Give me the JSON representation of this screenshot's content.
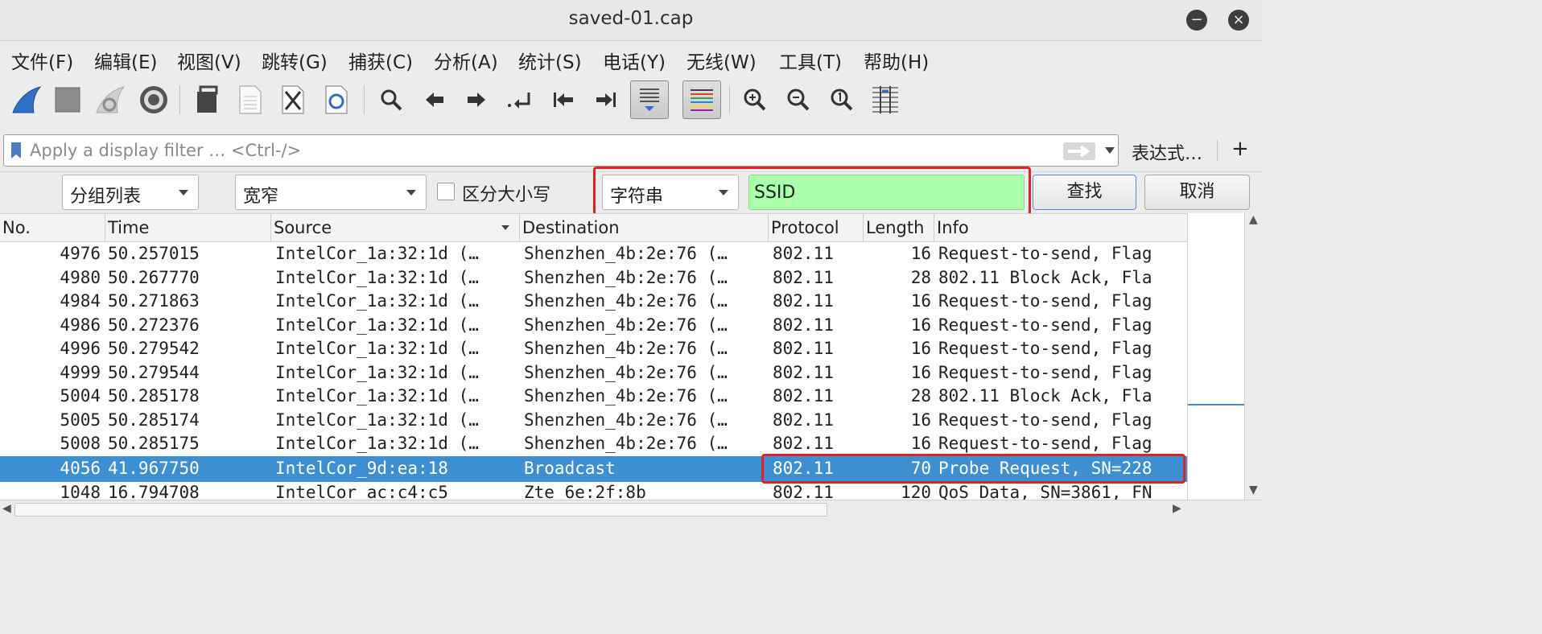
{
  "window": {
    "title": "saved-01.cap",
    "minimize": "−",
    "close": "×"
  },
  "menu": [
    "文件(F)",
    "编辑(E)",
    "视图(V)",
    "跳转(G)",
    "捕获(C)",
    "分析(A)",
    "统计(S)",
    "电话(Y)",
    "无线(W)",
    "工具(T)",
    "帮助(H)"
  ],
  "toolbar": {
    "icons": [
      "shark-fin-start-icon",
      "stop-square-icon",
      "restart-fin-icon",
      "capture-options-gear-icon",
      "open-file-icon",
      "save-file-icon",
      "close-file-icon",
      "reload-file-icon",
      "find-packet-icon",
      "go-back-icon",
      "go-forward-icon",
      "go-to-packet-icon",
      "first-packet-icon",
      "last-packet-icon",
      "autoscroll-icon",
      "colorize-icon",
      "zoom-in-icon",
      "zoom-out-icon",
      "normal-size-icon",
      "resize-columns-icon"
    ]
  },
  "filter": {
    "placeholder": "Apply a display filter … <Ctrl-/>",
    "expression_label": "表达式…",
    "add_label": "+"
  },
  "find": {
    "search_in": "分组列表",
    "char_width": "宽窄",
    "case_sensitive_label": "区分大小写",
    "search_type": "字符串",
    "search_value": "SSID",
    "find_label": "查找",
    "cancel_label": "取消"
  },
  "columns": [
    "No.",
    "Time",
    "Source",
    "Destination",
    "Protocol",
    "Length",
    "Info"
  ],
  "packets": [
    {
      "no": "4976",
      "time": "50.257015",
      "source": "IntelCor_1a:32:1d (…",
      "destination": "Shenzhen_4b:2e:76 (…",
      "protocol": "802.11",
      "length": "16",
      "info": "Request-to-send, Flag"
    },
    {
      "no": "4980",
      "time": "50.267770",
      "source": "IntelCor_1a:32:1d (…",
      "destination": "Shenzhen_4b:2e:76 (…",
      "protocol": "802.11",
      "length": "28",
      "info": "802.11 Block Ack, Fla"
    },
    {
      "no": "4984",
      "time": "50.271863",
      "source": "IntelCor_1a:32:1d (…",
      "destination": "Shenzhen_4b:2e:76 (…",
      "protocol": "802.11",
      "length": "16",
      "info": "Request-to-send, Flag"
    },
    {
      "no": "4986",
      "time": "50.272376",
      "source": "IntelCor_1a:32:1d (…",
      "destination": "Shenzhen_4b:2e:76 (…",
      "protocol": "802.11",
      "length": "16",
      "info": "Request-to-send, Flag"
    },
    {
      "no": "4996",
      "time": "50.279542",
      "source": "IntelCor_1a:32:1d (…",
      "destination": "Shenzhen_4b:2e:76 (…",
      "protocol": "802.11",
      "length": "16",
      "info": "Request-to-send, Flag"
    },
    {
      "no": "4999",
      "time": "50.279544",
      "source": "IntelCor_1a:32:1d (…",
      "destination": "Shenzhen_4b:2e:76 (…",
      "protocol": "802.11",
      "length": "16",
      "info": "Request-to-send, Flag"
    },
    {
      "no": "5004",
      "time": "50.285178",
      "source": "IntelCor_1a:32:1d (…",
      "destination": "Shenzhen_4b:2e:76 (…",
      "protocol": "802.11",
      "length": "28",
      "info": "802.11 Block Ack, Fla"
    },
    {
      "no": "5005",
      "time": "50.285174",
      "source": "IntelCor_1a:32:1d (…",
      "destination": "Shenzhen_4b:2e:76 (…",
      "protocol": "802.11",
      "length": "16",
      "info": "Request-to-send, Flag"
    },
    {
      "no": "5008",
      "time": "50.285175",
      "source": "IntelCor_1a:32:1d (…",
      "destination": "Shenzhen_4b:2e:76 (…",
      "protocol": "802.11",
      "length": "16",
      "info": "Request-to-send, Flag"
    },
    {
      "no": "4056",
      "time": "41.967750",
      "source": "IntelCor_9d:ea:18",
      "destination": "Broadcast",
      "protocol": "802.11",
      "length": "70",
      "info": "Probe Request, SN=228"
    },
    {
      "no": "1048",
      "time": "16.794708",
      "source": "IntelCor_ac:c4:c5",
      "destination": "Zte_6e:2f:8b",
      "protocol": "802.11",
      "length": "120",
      "info": "QoS Data, SN=3861, FN"
    }
  ],
  "selected_row": 9,
  "colors": {
    "selection": "#3d8fd1",
    "search_match": "#aaffaa",
    "highlight_box": "#e52020"
  }
}
